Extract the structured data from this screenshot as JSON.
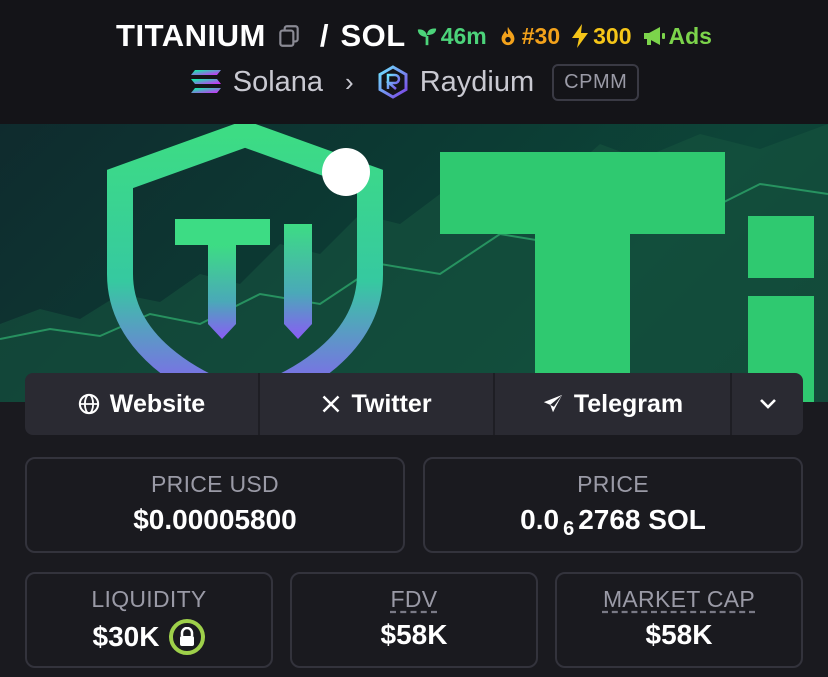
{
  "header": {
    "symbol": "TITANIUM",
    "quote": "SOL",
    "separator": "/",
    "age": "46m",
    "rank": "#30",
    "boosts": "300",
    "ads": "Ads"
  },
  "chain": {
    "network": "Solana",
    "dex": "Raydium",
    "pool_type": "CPMM"
  },
  "links": {
    "website": "Website",
    "twitter": "Twitter",
    "telegram": "Telegram"
  },
  "stats": {
    "price_usd_label": "PRICE USD",
    "price_usd_value": "$0.00005800",
    "price_label": "PRICE",
    "price_prefix": "0.0",
    "price_zeros": "6",
    "price_digits": "2768 SOL",
    "liquidity_label": "LIQUIDITY",
    "liquidity_value": "$30K",
    "fdv_label": "FDV",
    "fdv_value": "$58K",
    "mcap_label": "MARKET CAP",
    "mcap_value": "$58K"
  },
  "banner": {
    "logo_text": "Ti",
    "big_text": "Ti"
  },
  "colors": {
    "background": "#1a1a1f",
    "age_green": "#4cd37a",
    "rank_orange": "#f3a21b",
    "boost_yellow": "#f5c518",
    "ads_green": "#7cd44b",
    "lock_green": "#9ed04a",
    "brand_green": "#3ddc84",
    "brand_purple": "#8a5cf5"
  }
}
